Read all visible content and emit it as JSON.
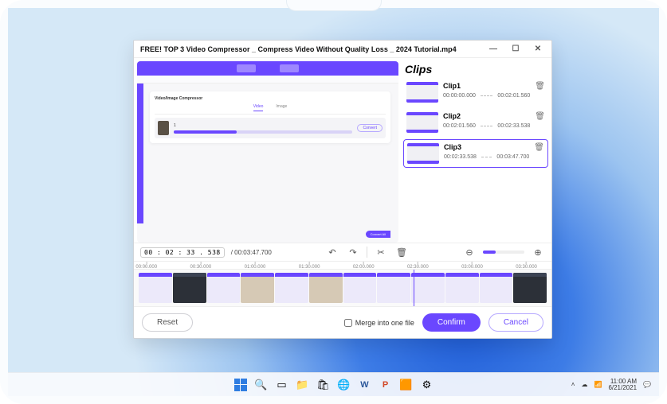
{
  "window": {
    "title": "FREE! TOP 3 Video Compressor _ Compress Video Without Quality Loss _ 2024 Tutorial.mp4"
  },
  "preview": {
    "panel_title": "Video/Image Compressor",
    "tab_video": "Video",
    "tab_image": "Image",
    "item_index": "1",
    "convert_label": "Convert",
    "convert_all_label": "Convert All"
  },
  "clips": {
    "heading": "Clips",
    "items": [
      {
        "name": "Clip1",
        "start": "00:00:00.000",
        "end": "00:02:01.560"
      },
      {
        "name": "Clip2",
        "start": "00:02:01.560",
        "end": "00:02:33.538"
      },
      {
        "name": "Clip3",
        "start": "00:02:33.538",
        "end": "00:03:47.700"
      }
    ]
  },
  "timeline": {
    "position": "00 : 02 : 33 . 538",
    "duration": "/ 00:03:47.700",
    "ruler": [
      "00:00.000",
      "00:30.000",
      "01:00.000",
      "01:30.000",
      "02:00.000",
      "02:30.000",
      "03:00.000",
      "03:30.000"
    ],
    "playhead_pct": 67
  },
  "actions": {
    "reset": "Reset",
    "merge": "Merge into one file",
    "confirm": "Confirm",
    "cancel": "Cancel"
  },
  "taskbar": {
    "time": "11:00 AM",
    "date": "6/21/2021"
  }
}
